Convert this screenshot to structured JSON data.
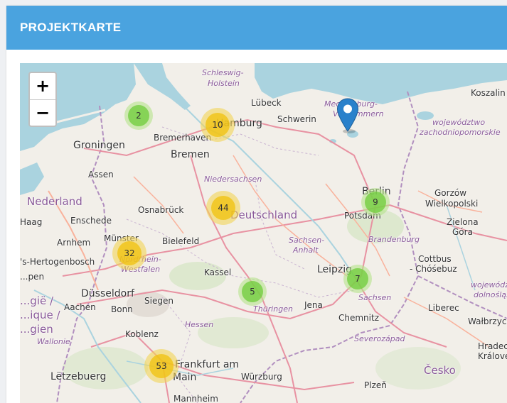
{
  "header": {
    "title": "PROJEKTKARTE"
  },
  "zoom": {
    "in_label": "+",
    "out_label": "−"
  },
  "clusters": [
    {
      "id": "nordsee",
      "count": "2",
      "size": "small"
    },
    {
      "id": "hamburg",
      "count": "10",
      "size": "medium"
    },
    {
      "id": "niedersachsen",
      "count": "44",
      "size": "medium"
    },
    {
      "id": "berlin",
      "count": "9",
      "size": "small"
    },
    {
      "id": "muenster",
      "count": "32",
      "size": "medium"
    },
    {
      "id": "leipzig",
      "count": "7",
      "size": "small"
    },
    {
      "id": "kassel",
      "count": "5",
      "size": "small"
    },
    {
      "id": "frankfurt",
      "count": "53",
      "size": "medium"
    }
  ],
  "map_labels": {
    "schleswig": "Schleswig-",
    "holstein": "Holstein",
    "luebeck": "Lübeck",
    "mecklenburg": "Mecklenburg-",
    "vorpommern": "Vorpommern",
    "koszalin": "Koszalin",
    "wojewodztwo": "województwo",
    "zachodniopomorskie": "zachodniopomorskie",
    "hamburg": "Hamburg",
    "schwerin": "Schwerin",
    "bremerhaven": "Bremerhaven",
    "groningen": "Groningen",
    "bremen": "Bremen",
    "assen": "Assen",
    "niedersachsen": "Niedersachsen",
    "berlin": "Berlin",
    "gorzow": "Gorzów",
    "wielkopolski": "Wielkopolski",
    "nederland": "Nederland",
    "osnabrueck": "Osnabrück",
    "deutschland": "Deutschland",
    "potsdam": "Potsdam",
    "haag": "Haag",
    "enschede": "Enschede",
    "zielona": "Zielona",
    "gora": "Góra",
    "muenster": "Münster",
    "bielefeld": "Bielefeld",
    "arnhem": "Arnhem",
    "sachsen_anhalt_1": "Sachsen-",
    "sachsen_anhalt_2": "Anhalt",
    "brandenburg": "Brandenburg",
    "hertogenbosch": "'s-Hertogenbosch",
    "nordrhein": "Nordrhein-",
    "westfalen": "Westfalen",
    "cottbus": "Cottbus",
    "chosebuz": "- Chóśebuz",
    "kassel": "Kassel",
    "leipzig": "Leipzig",
    "eindhoven": "...pen",
    "duesseldorf": "Düsseldorf",
    "siegen": "Siegen",
    "wojewodztwo2": "wojewódz",
    "dolnoslaskie": "dolnośląs",
    "aachen": "Aachen",
    "bonn": "Bonn",
    "jena": "Jena",
    "sachsen": "Sachsen",
    "thueringen": "Thüringen",
    "liberec": "Liberec",
    "belgie": "...gië /",
    "belgique": "...ique /",
    "belgien": "...gien",
    "hessen": "Hessen",
    "chemnitz": "Chemnitz",
    "walbrzych": "Wałbrzych",
    "koblenz": "Koblenz",
    "wallonie": "Wallonie",
    "severozapad": "Severozápad",
    "hradec": "Hradec",
    "kralove": "Králové",
    "letzebuerg": "Lëtzebuerg",
    "frankfurt1": "Frankfurt am",
    "frankfurt2": "Main",
    "wuerzburg": "Würzburg",
    "cesko": "Česko",
    "plzen": "Plzeň",
    "mannheim": "Mannheim"
  },
  "colors": {
    "header": "#4aa3df",
    "water": "#aad3df",
    "land": "#f2efe9",
    "marker": "#2a81cb"
  },
  "marker": {
    "icon": "map-pin-icon"
  }
}
